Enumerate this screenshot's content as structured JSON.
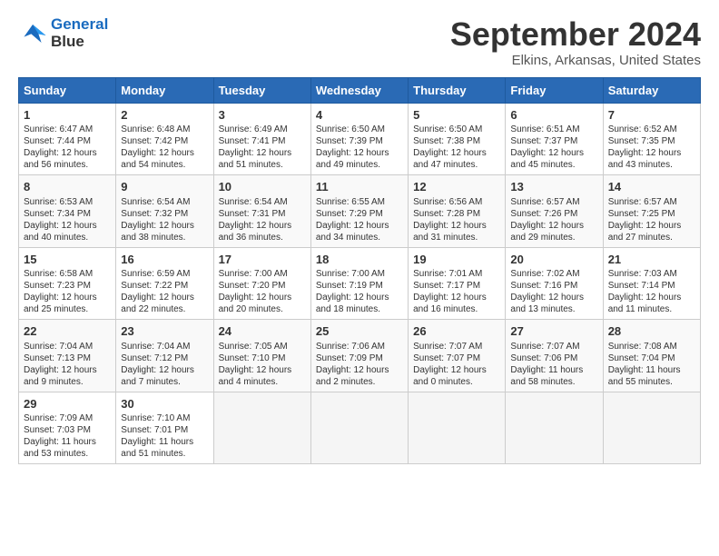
{
  "logo": {
    "line1": "General",
    "line2": "Blue"
  },
  "title": "September 2024",
  "subtitle": "Elkins, Arkansas, United States",
  "headers": [
    "Sunday",
    "Monday",
    "Tuesday",
    "Wednesday",
    "Thursday",
    "Friday",
    "Saturday"
  ],
  "weeks": [
    [
      {
        "day": "1",
        "content": "Sunrise: 6:47 AM\nSunset: 7:44 PM\nDaylight: 12 hours\nand 56 minutes."
      },
      {
        "day": "2",
        "content": "Sunrise: 6:48 AM\nSunset: 7:42 PM\nDaylight: 12 hours\nand 54 minutes."
      },
      {
        "day": "3",
        "content": "Sunrise: 6:49 AM\nSunset: 7:41 PM\nDaylight: 12 hours\nand 51 minutes."
      },
      {
        "day": "4",
        "content": "Sunrise: 6:50 AM\nSunset: 7:39 PM\nDaylight: 12 hours\nand 49 minutes."
      },
      {
        "day": "5",
        "content": "Sunrise: 6:50 AM\nSunset: 7:38 PM\nDaylight: 12 hours\nand 47 minutes."
      },
      {
        "day": "6",
        "content": "Sunrise: 6:51 AM\nSunset: 7:37 PM\nDaylight: 12 hours\nand 45 minutes."
      },
      {
        "day": "7",
        "content": "Sunrise: 6:52 AM\nSunset: 7:35 PM\nDaylight: 12 hours\nand 43 minutes."
      }
    ],
    [
      {
        "day": "8",
        "content": "Sunrise: 6:53 AM\nSunset: 7:34 PM\nDaylight: 12 hours\nand 40 minutes."
      },
      {
        "day": "9",
        "content": "Sunrise: 6:54 AM\nSunset: 7:32 PM\nDaylight: 12 hours\nand 38 minutes."
      },
      {
        "day": "10",
        "content": "Sunrise: 6:54 AM\nSunset: 7:31 PM\nDaylight: 12 hours\nand 36 minutes."
      },
      {
        "day": "11",
        "content": "Sunrise: 6:55 AM\nSunset: 7:29 PM\nDaylight: 12 hours\nand 34 minutes."
      },
      {
        "day": "12",
        "content": "Sunrise: 6:56 AM\nSunset: 7:28 PM\nDaylight: 12 hours\nand 31 minutes."
      },
      {
        "day": "13",
        "content": "Sunrise: 6:57 AM\nSunset: 7:26 PM\nDaylight: 12 hours\nand 29 minutes."
      },
      {
        "day": "14",
        "content": "Sunrise: 6:57 AM\nSunset: 7:25 PM\nDaylight: 12 hours\nand 27 minutes."
      }
    ],
    [
      {
        "day": "15",
        "content": "Sunrise: 6:58 AM\nSunset: 7:23 PM\nDaylight: 12 hours\nand 25 minutes."
      },
      {
        "day": "16",
        "content": "Sunrise: 6:59 AM\nSunset: 7:22 PM\nDaylight: 12 hours\nand 22 minutes."
      },
      {
        "day": "17",
        "content": "Sunrise: 7:00 AM\nSunset: 7:20 PM\nDaylight: 12 hours\nand 20 minutes."
      },
      {
        "day": "18",
        "content": "Sunrise: 7:00 AM\nSunset: 7:19 PM\nDaylight: 12 hours\nand 18 minutes."
      },
      {
        "day": "19",
        "content": "Sunrise: 7:01 AM\nSunset: 7:17 PM\nDaylight: 12 hours\nand 16 minutes."
      },
      {
        "day": "20",
        "content": "Sunrise: 7:02 AM\nSunset: 7:16 PM\nDaylight: 12 hours\nand 13 minutes."
      },
      {
        "day": "21",
        "content": "Sunrise: 7:03 AM\nSunset: 7:14 PM\nDaylight: 12 hours\nand 11 minutes."
      }
    ],
    [
      {
        "day": "22",
        "content": "Sunrise: 7:04 AM\nSunset: 7:13 PM\nDaylight: 12 hours\nand 9 minutes."
      },
      {
        "day": "23",
        "content": "Sunrise: 7:04 AM\nSunset: 7:12 PM\nDaylight: 12 hours\nand 7 minutes."
      },
      {
        "day": "24",
        "content": "Sunrise: 7:05 AM\nSunset: 7:10 PM\nDaylight: 12 hours\nand 4 minutes."
      },
      {
        "day": "25",
        "content": "Sunrise: 7:06 AM\nSunset: 7:09 PM\nDaylight: 12 hours\nand 2 minutes."
      },
      {
        "day": "26",
        "content": "Sunrise: 7:07 AM\nSunset: 7:07 PM\nDaylight: 12 hours\nand 0 minutes."
      },
      {
        "day": "27",
        "content": "Sunrise: 7:07 AM\nSunset: 7:06 PM\nDaylight: 11 hours\nand 58 minutes."
      },
      {
        "day": "28",
        "content": "Sunrise: 7:08 AM\nSunset: 7:04 PM\nDaylight: 11 hours\nand 55 minutes."
      }
    ],
    [
      {
        "day": "29",
        "content": "Sunrise: 7:09 AM\nSunset: 7:03 PM\nDaylight: 11 hours\nand 53 minutes."
      },
      {
        "day": "30",
        "content": "Sunrise: 7:10 AM\nSunset: 7:01 PM\nDaylight: 11 hours\nand 51 minutes."
      },
      {
        "day": "",
        "content": ""
      },
      {
        "day": "",
        "content": ""
      },
      {
        "day": "",
        "content": ""
      },
      {
        "day": "",
        "content": ""
      },
      {
        "day": "",
        "content": ""
      }
    ]
  ]
}
